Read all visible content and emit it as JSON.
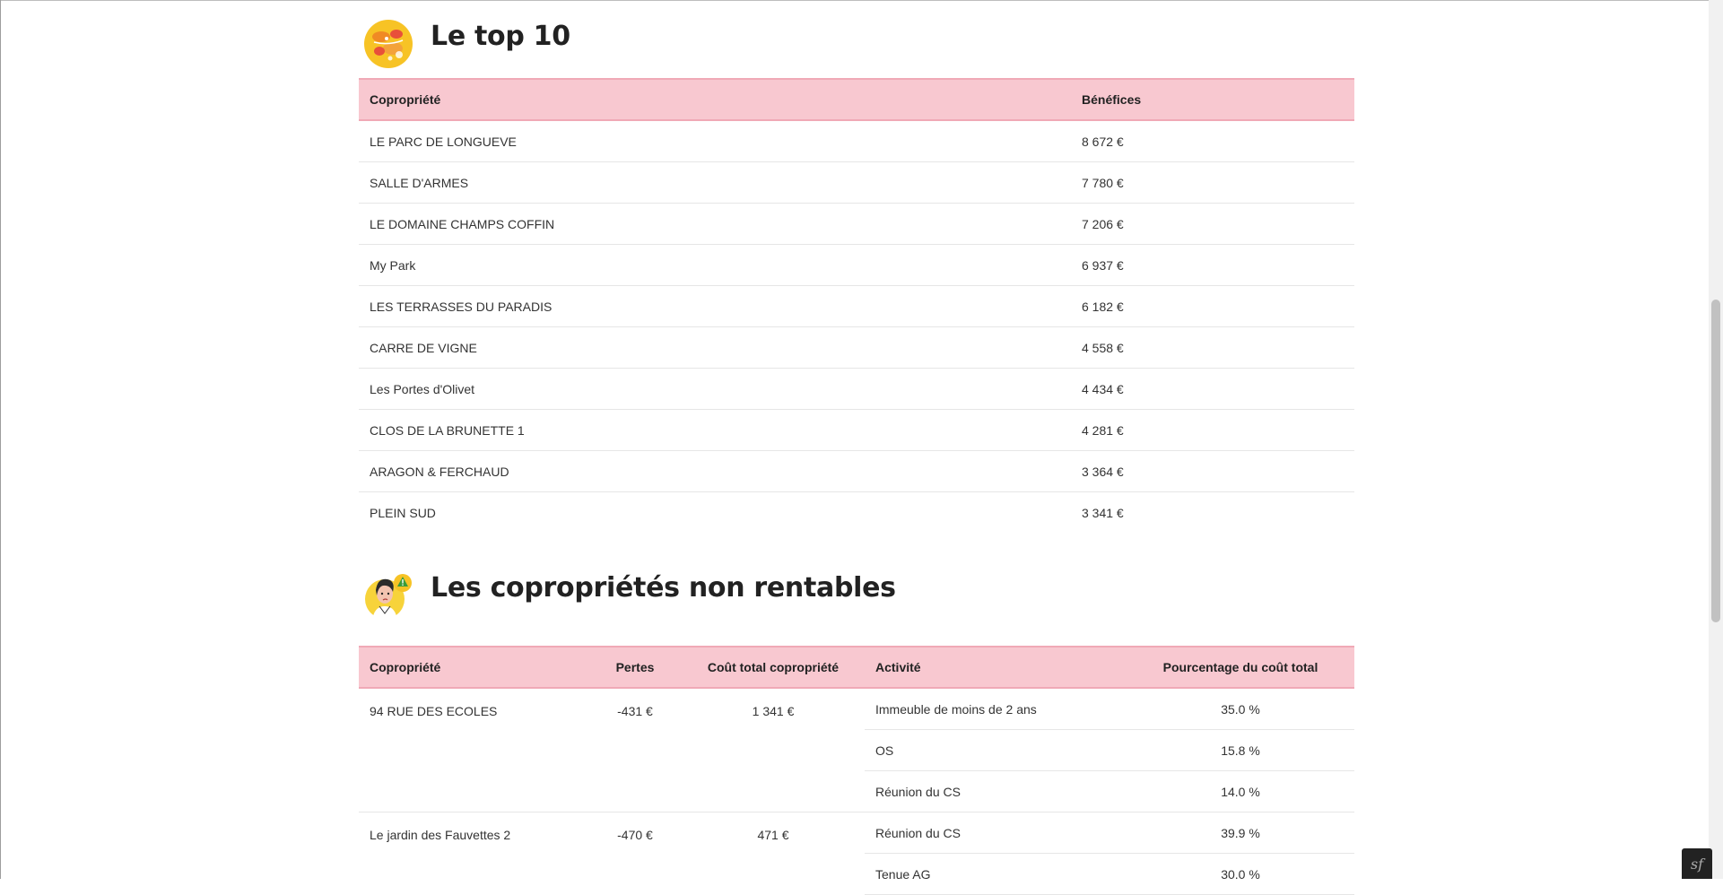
{
  "top10": {
    "title": "Le top 10",
    "icon": "food-bowl-icon",
    "headers": {
      "copro": "Copropriété",
      "benef": "Bénéfices"
    },
    "rows": [
      {
        "name": "LE PARC DE LONGUEVE",
        "value": "8 672 €"
      },
      {
        "name": "SALLE D'ARMES",
        "value": "7 780 €"
      },
      {
        "name": "LE DOMAINE CHAMPS COFFIN",
        "value": "7 206 €"
      },
      {
        "name": "My Park",
        "value": "6 937 €"
      },
      {
        "name": "LES TERRASSES DU PARADIS",
        "value": "6 182 €"
      },
      {
        "name": "CARRE DE VIGNE",
        "value": "4 558 €"
      },
      {
        "name": "Les Portes d'Olivet",
        "value": "4 434 €"
      },
      {
        "name": "CLOS DE LA BRUNETTE 1",
        "value": "4 281 €"
      },
      {
        "name": "ARAGON & FERCHAUD",
        "value": "3 364 €"
      },
      {
        "name": "PLEIN SUD",
        "value": "3 341 €"
      }
    ]
  },
  "loss": {
    "title": "Les copropriétés non rentables",
    "icon": "worried-person-warning-icon",
    "headers": {
      "copro": "Copropriété",
      "pertes": "Pertes",
      "cout": "Coût total copropriété",
      "activite": "Activité",
      "pourcentage": "Pourcentage du coût total"
    },
    "groups": [
      {
        "name": "94 RUE DES ECOLES",
        "pertes": "-431 €",
        "cout": "1 341 €",
        "activities": [
          {
            "label": "Immeuble de moins de 2 ans",
            "pct": "35.0 %"
          },
          {
            "label": "OS",
            "pct": "15.8 %"
          },
          {
            "label": "Réunion du CS",
            "pct": "14.0 %"
          }
        ]
      },
      {
        "name": "Le jardin des Fauvettes 2",
        "pertes": "-470 €",
        "cout": "471 €",
        "activities": [
          {
            "label": "Réunion du CS",
            "pct": "39.9 %"
          },
          {
            "label": "Tenue AG",
            "pct": "30.0 %"
          }
        ]
      }
    ]
  },
  "colors": {
    "header_bg": "#f8c8d0",
    "header_border": "#f0a9b6"
  },
  "toolbar": {
    "icon": "symfony-icon",
    "glyph": "sf"
  }
}
